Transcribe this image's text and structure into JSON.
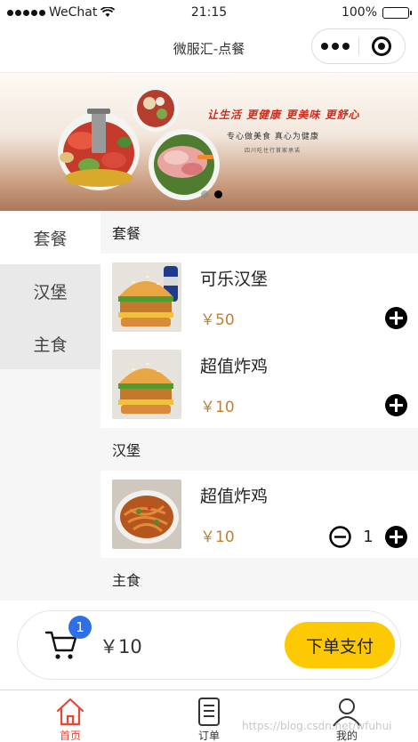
{
  "status_bar": {
    "carrier": "WeChat",
    "time": "21:15",
    "battery": "100%",
    "battery_level": 1.0
  },
  "navbar": {
    "title": "微服汇-点餐"
  },
  "banner": {
    "slogan": "让生活 更健康 更美味 更舒心",
    "subslogan": "专心做美食 真心为健康",
    "tagline": "四川吃住行首家承诺",
    "active_slide": 2,
    "slide_count": 2
  },
  "sidebar": {
    "items": [
      {
        "label": "套餐",
        "active": true
      },
      {
        "label": "汉堡",
        "active": false
      },
      {
        "label": "主食",
        "active": false
      }
    ]
  },
  "menu": {
    "categories": [
      {
        "title": "套餐",
        "dishes": [
          {
            "name": "可乐汉堡",
            "price": "￥50",
            "image": "burger-with-cola",
            "quantity": 0
          },
          {
            "name": "超值炸鸡",
            "price": "￥10",
            "image": "burger",
            "quantity": 0
          }
        ]
      },
      {
        "title": "汉堡",
        "dishes": [
          {
            "name": "超值炸鸡",
            "price": "￥10",
            "image": "fried-noodles",
            "quantity": "1"
          }
        ]
      },
      {
        "title": "主食",
        "dishes": []
      }
    ]
  },
  "cart": {
    "count": "1",
    "total": "￥10",
    "checkout_label": "下单支付"
  },
  "tabbar": {
    "tabs": [
      {
        "label": "首页",
        "icon": "home-icon",
        "active": true
      },
      {
        "label": "订单",
        "icon": "order-icon",
        "active": false
      },
      {
        "label": "我的",
        "icon": "user-icon",
        "active": false
      }
    ]
  },
  "watermark": "https://blog.csdn.net/wfuhui",
  "colors": {
    "accent": "#fdc903",
    "price": "#c0822a",
    "badge": "#2f6fe6",
    "active_tab": "#e94633"
  }
}
